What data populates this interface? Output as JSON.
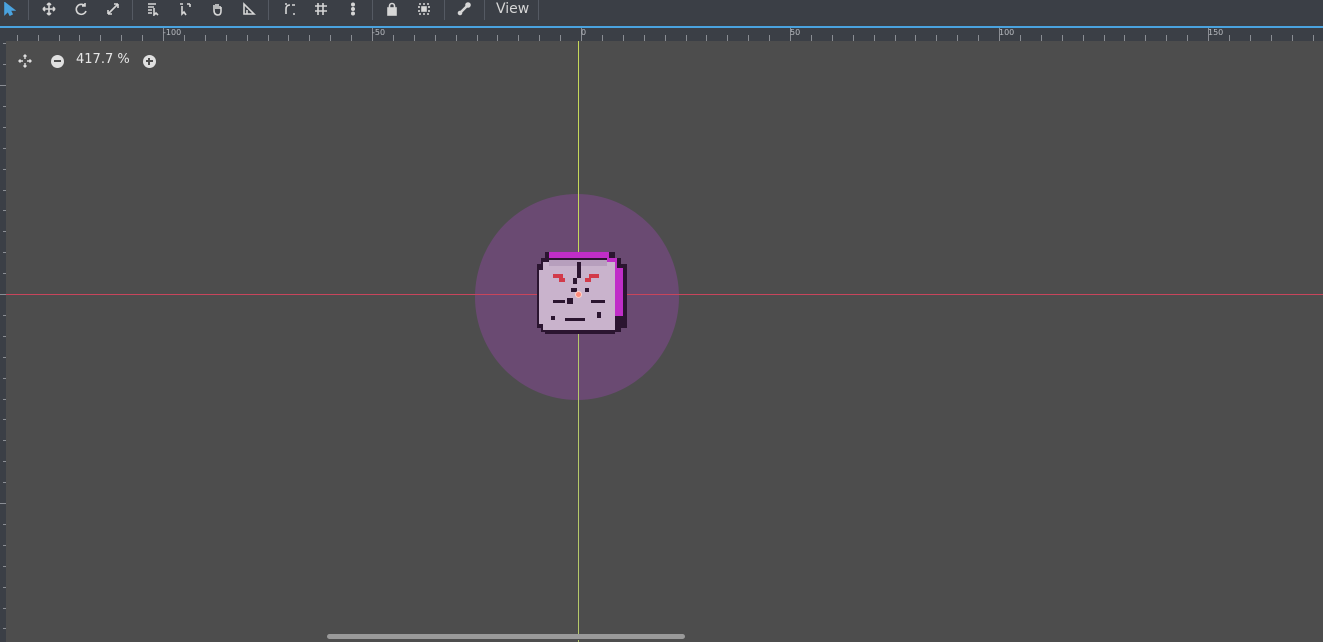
{
  "toolbar": {
    "tools": [
      {
        "name": "select-tool-icon",
        "active": true
      },
      {
        "name": "move-tool-icon"
      },
      {
        "name": "rotate-tool-icon"
      },
      {
        "name": "scale-tool-icon"
      },
      {
        "name": "list-select-icon"
      },
      {
        "name": "pivot-tool-icon"
      },
      {
        "name": "pan-tool-icon"
      },
      {
        "name": "ruler-tool-icon"
      },
      {
        "name": "smart-snap-icon"
      },
      {
        "name": "grid-snap-icon"
      },
      {
        "name": "more-options-icon"
      },
      {
        "name": "lock-icon"
      },
      {
        "name": "group-icon"
      },
      {
        "name": "skeleton-bone-icon"
      }
    ],
    "view_label": "View"
  },
  "ruler": {
    "labels": [
      "-100",
      "-50",
      "0",
      "50",
      "100",
      "150"
    ]
  },
  "zoom": {
    "level": "417.7 %"
  },
  "colors": {
    "accent": "#4aa3df",
    "viewport_bg": "#4d4d4d",
    "x_axis": "#c8455c",
    "y_axis": "#b6c96a",
    "collision_area": "#6a4a72"
  }
}
